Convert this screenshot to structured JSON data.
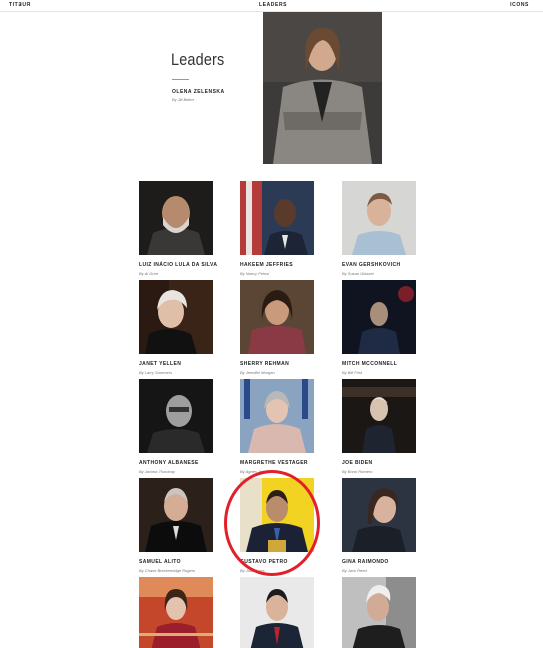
{
  "nav": {
    "left": "TIT∃UЯ",
    "center": "LEADERS",
    "right": "ICONS"
  },
  "hero": {
    "title": "Leaders",
    "name": "OLENA ZELENSKA",
    "byline": "By Jill Biden"
  },
  "leaders": [
    {
      "name": "LUIZ INÁCIO LULA DA SILVA",
      "byline": "By Al Gore"
    },
    {
      "name": "HAKEEM JEFFRIES",
      "byline": "By Nancy Pelosi"
    },
    {
      "name": "EVAN GERSHKOVICH",
      "byline": "By Susan Glasser"
    },
    {
      "name": "JANET YELLEN",
      "byline": "By Larry Summers"
    },
    {
      "name": "SHERRY REHMAN",
      "byline": "By Jennifer Morgan"
    },
    {
      "name": "MITCH MCCONNELL",
      "byline": "By Bill Frist"
    },
    {
      "name": "ANTHONY ALBANESE",
      "byline": "By Jacinta Thackray"
    },
    {
      "name": "MARGRETHE VESTAGER",
      "byline": "By Agnès Joinet"
    },
    {
      "name": "JOE BIDEN",
      "byline": "By Bono Romero"
    },
    {
      "name": "SAMUEL ALITO",
      "byline": "By Chase Breckenridge Rogers"
    },
    {
      "name": "GUSTAVO PETRO",
      "byline": "By Juan Navs"
    },
    {
      "name": "GINA RAIMONDO",
      "byline": "By Jack Reed"
    },
    {
      "name": "",
      "byline": ""
    },
    {
      "name": "",
      "byline": ""
    },
    {
      "name": "",
      "byline": ""
    }
  ],
  "annotation": {
    "color": "#e3202a"
  }
}
